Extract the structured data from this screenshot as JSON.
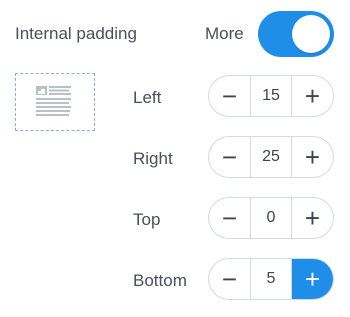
{
  "header": {
    "title": "Internal padding",
    "more_label": "More",
    "toggle_on": true
  },
  "colors": {
    "accent": "#1f8ee8",
    "text": "#4a4f5c",
    "border": "#d5d9e0"
  },
  "paddings": [
    {
      "label": "Left",
      "value": "15",
      "minus": "−",
      "plus": "+"
    },
    {
      "label": "Right",
      "value": "25",
      "minus": "−",
      "plus": "+"
    },
    {
      "label": "Top",
      "value": "0",
      "minus": "−",
      "plus": "+"
    },
    {
      "label": "Bottom",
      "value": "5",
      "minus": "−",
      "plus": "+"
    }
  ]
}
